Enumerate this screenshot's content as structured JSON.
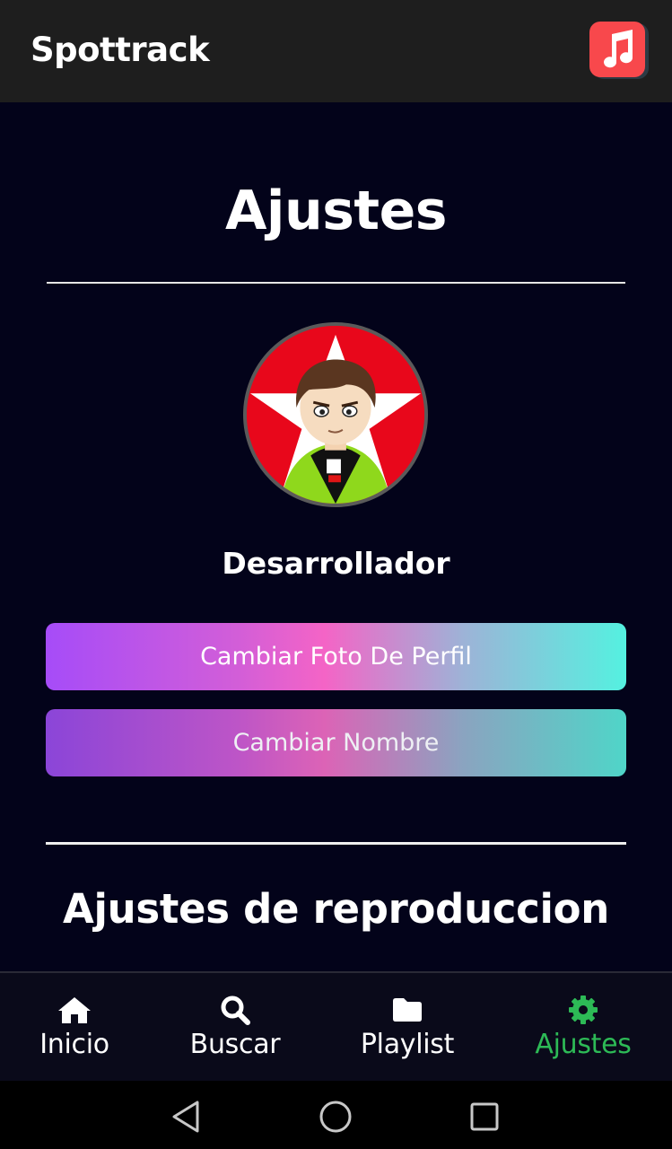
{
  "app": {
    "title": "Spottrack",
    "logo_icon": "music-note-icon",
    "logo_color": "#f8484c"
  },
  "settings": {
    "title": "Ajustes",
    "avatar_icon": "profile-avatar",
    "user_name": "Desarrollador",
    "change_photo_label": "Cambiar Foto De Perfil",
    "change_name_label": "Cambiar Nombre",
    "playback_section_title": "Ajustes de reproduccion"
  },
  "bottom_nav": {
    "items": [
      {
        "label": "Inicio",
        "icon": "home-icon"
      },
      {
        "label": "Buscar",
        "icon": "search-icon"
      },
      {
        "label": "Playlist",
        "icon": "folder-icon"
      },
      {
        "label": "Ajustes",
        "icon": "gear-icon",
        "active": true
      }
    ],
    "active_color": "#2dba56"
  },
  "system_nav": {
    "back_icon": "back-triangle-icon",
    "home_icon": "home-circle-icon",
    "recents_icon": "recents-square-icon"
  }
}
